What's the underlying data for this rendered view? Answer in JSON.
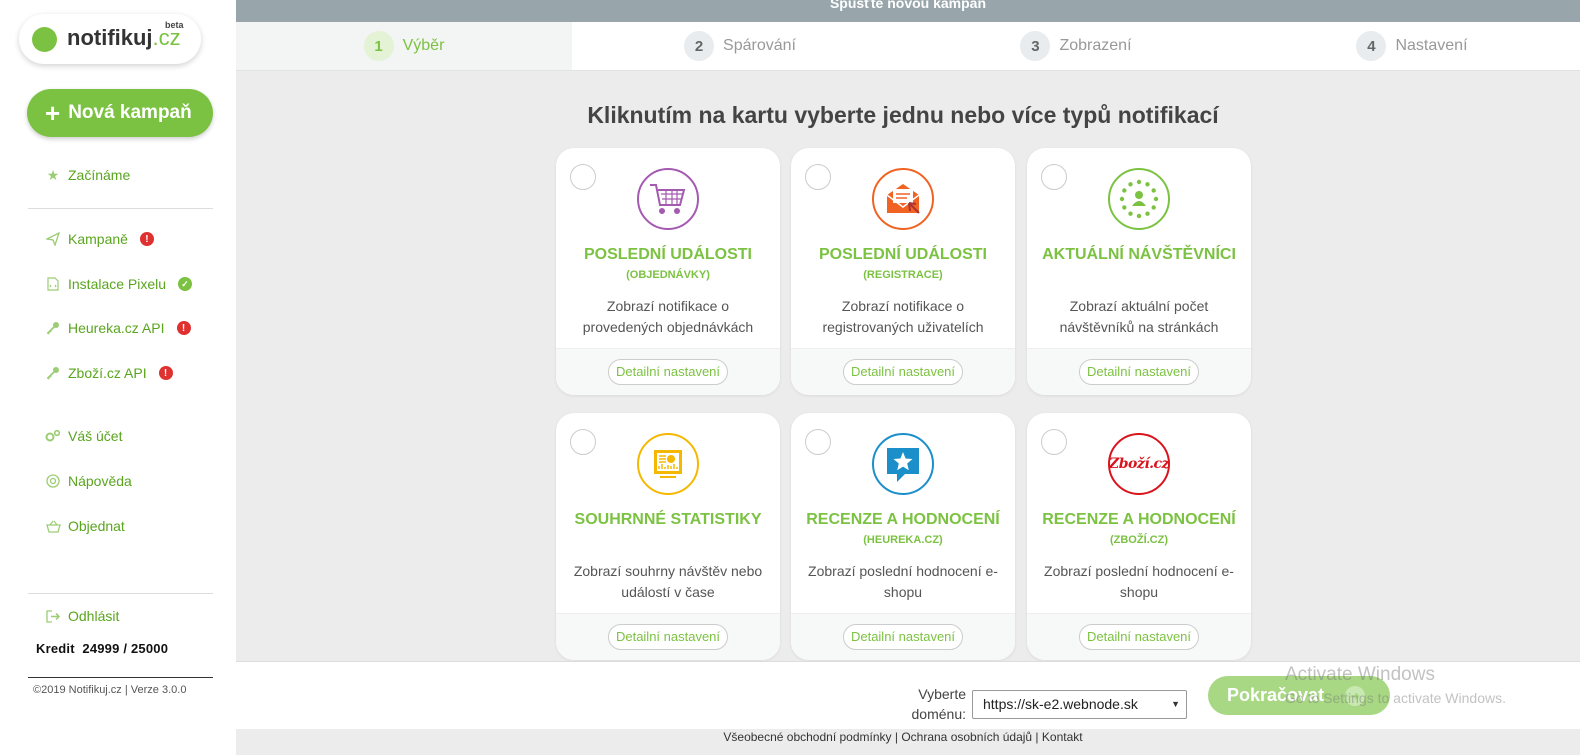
{
  "logo": {
    "name": "notifikuj",
    "tld": ".cz",
    "tag": "beta"
  },
  "sidebar": {
    "new_campaign": "Nová kampaň",
    "items": [
      {
        "label": "Začínáme",
        "icon": "star-icon"
      },
      {
        "label": "Kampaně",
        "icon": "paper-plane-icon",
        "status": "!"
      },
      {
        "label": "Instalace Pixelu",
        "icon": "file-code-icon",
        "status": "✓"
      },
      {
        "label": "Heureka.cz API",
        "icon": "key-icon",
        "status": "!"
      },
      {
        "label": "Zboží.cz API",
        "icon": "key-icon",
        "status": "!"
      },
      {
        "label": "Váš účet",
        "icon": "gears-icon"
      },
      {
        "label": "Nápověda",
        "icon": "lifebuoy-icon"
      },
      {
        "label": "Objednat",
        "icon": "basket-icon"
      },
      {
        "label": "Odhlásit",
        "icon": "sign-out-icon"
      }
    ],
    "credit": "Kredit  24999 / 25000",
    "copyright": "©2019 Notifikuj.cz | Verze 3.0.0"
  },
  "topbar": {
    "title": "Spusťte novou kampaň"
  },
  "steps": [
    {
      "num": "1",
      "label": "Výběr"
    },
    {
      "num": "2",
      "label": "Spárování"
    },
    {
      "num": "3",
      "label": "Zobrazení"
    },
    {
      "num": "4",
      "label": "Nastavení"
    }
  ],
  "heading": "Kliknutím na kartu vyberte jednu nebo více typů notifikací",
  "cards": [
    {
      "title": "POSLEDNÍ UDÁLOSTI",
      "subtitle": "(OBJEDNÁVKY)",
      "desc": "Zobrazí notifikace o provedených objednávkách",
      "button": "Detailní nastavení",
      "icon": "shopping-cart-icon",
      "color": "#a45ab0"
    },
    {
      "title": "POSLEDNÍ UDÁLOSTI",
      "subtitle": "(REGISTRACE)",
      "desc": "Zobrazí notifikace o registrovaných uživatelích",
      "button": "Detailní nastavení",
      "icon": "envelope-icon",
      "color": "#f06322"
    },
    {
      "title": "AKTUÁLNÍ NÁVŠTĚVNÍCI",
      "subtitle": "",
      "desc": "Zobrazí aktuální počet návštěvníků na stránkách",
      "button": "Detailní nastavení",
      "icon": "visitor-icon",
      "color": "#7cc242"
    },
    {
      "title": "SOUHRNNÉ STATISTIKY",
      "subtitle": "",
      "desc": "Zobrazí souhrny návštěv nebo událostí v čase",
      "button": "Detailní nastavení",
      "icon": "statistics-icon",
      "color": "#f5b800"
    },
    {
      "title": "RECENZE A HODNOCENÍ",
      "subtitle": "(HEUREKA.CZ)",
      "desc": "Zobrazí poslední hodnocení e-shopu",
      "button": "Detailní nastavení",
      "icon": "star-bubble-icon",
      "color": "#1a8fc9"
    },
    {
      "title": "RECENZE A HODNOCENÍ",
      "subtitle": "(ZBOŽÍ.CZ)",
      "desc": "Zobrazí poslední hodnocení e-shopu",
      "button": "Detailní nastavení",
      "icon": "zbozi-logo-icon",
      "color": "#d9141c",
      "logo_text": "Zboží.cz"
    }
  ],
  "bottom": {
    "domain_label": "Vyberte doménu:",
    "domain_value": "https://sk-e2.webnode.sk",
    "continue": "Pokračovat"
  },
  "footer": {
    "terms": "Všeobecné obchodní podmínky",
    "privacy": "Ochrana osobních údajů",
    "contact": "Kontakt"
  },
  "watermark": {
    "line1": "Activate Windows",
    "line2": "Go to Settings to activate Windows."
  }
}
